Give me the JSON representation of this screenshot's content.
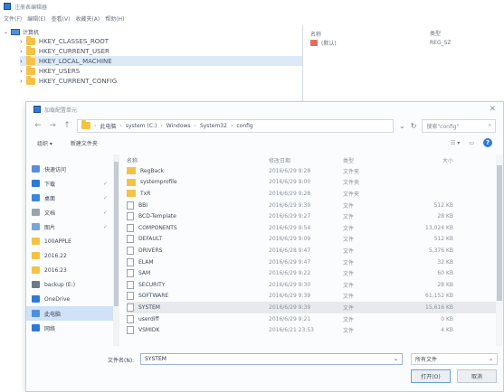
{
  "regedit": {
    "title": "注册表编辑器",
    "menu": [
      "文件(F)",
      "编辑(E)",
      "查看(V)",
      "收藏夹(A)",
      "帮助(H)"
    ],
    "tree_root": "计算机",
    "tree_items": [
      {
        "label": "HKEY_CLASSES_ROOT",
        "selected": false
      },
      {
        "label": "HKEY_CURRENT_USER",
        "selected": false
      },
      {
        "label": "HKEY_LOCAL_MACHINE",
        "selected": true
      },
      {
        "label": "HKEY_USERS",
        "selected": false
      },
      {
        "label": "HKEY_CURRENT_CONFIG",
        "selected": false
      }
    ],
    "values_header": {
      "name": "名称",
      "type": "类型"
    },
    "values_rows": [
      {
        "name": "(默认)",
        "type": "REG_SZ"
      }
    ]
  },
  "dialog": {
    "title": "加载配置单元",
    "breadcrumb": [
      "此电脑",
      "system (C:)",
      "Windows",
      "System32",
      "config"
    ],
    "search_placeholder": "搜索\"config\"",
    "toolbar": {
      "organize": "组织 ▾",
      "new_folder": "新建文件夹"
    },
    "nav_items": [
      {
        "label": "快速访问",
        "color": "#5a8fd6",
        "pinned": false,
        "selected": false
      },
      {
        "label": "下载",
        "color": "#2f79d6",
        "pinned": true,
        "selected": false
      },
      {
        "label": "桌面",
        "color": "#3e86d8",
        "pinned": true,
        "selected": false
      },
      {
        "label": "文档",
        "color": "#9aa4ae",
        "pinned": true,
        "selected": false
      },
      {
        "label": "图片",
        "color": "#7aa6d6",
        "pinned": true,
        "selected": false
      },
      {
        "label": "100APPLE",
        "color": "#f5c246",
        "pinned": false,
        "selected": false
      },
      {
        "label": "2016.22",
        "color": "#f5c246",
        "pinned": false,
        "selected": false
      },
      {
        "label": "2016.23",
        "color": "#f5c246",
        "pinned": false,
        "selected": false
      },
      {
        "label": "backup (E:)",
        "color": "#6f7986",
        "pinned": false,
        "selected": false
      },
      {
        "label": "OneDrive",
        "color": "#2f79d6",
        "pinned": false,
        "selected": false
      },
      {
        "label": "此电脑",
        "color": "#4d90e0",
        "pinned": false,
        "selected": true
      },
      {
        "label": "网络",
        "color": "#2f79d6",
        "pinned": false,
        "selected": false
      }
    ],
    "columns": {
      "name": "名称",
      "date": "修改日期",
      "type": "类型",
      "size": "大小"
    },
    "files": [
      {
        "name": "RegBack",
        "date": "2016/6/29 9:28",
        "type": "文件夹",
        "size": "",
        "folder": true,
        "selected": false
      },
      {
        "name": "systemprofile",
        "date": "2016/6/29 9:00",
        "type": "文件夹",
        "size": "",
        "folder": true,
        "selected": false
      },
      {
        "name": "TxR",
        "date": "2016/6/29 9:28",
        "type": "文件夹",
        "size": "",
        "folder": true,
        "selected": false
      },
      {
        "name": "BBI",
        "date": "2016/6/29 9:39",
        "type": "文件",
        "size": "512 KB",
        "folder": false,
        "selected": false
      },
      {
        "name": "BCD-Template",
        "date": "2016/6/29 9:27",
        "type": "文件",
        "size": "28 KB",
        "folder": false,
        "selected": false
      },
      {
        "name": "COMPONENTS",
        "date": "2016/6/29 9:54",
        "type": "文件",
        "size": "13,024 KB",
        "folder": false,
        "selected": false
      },
      {
        "name": "DEFAULT",
        "date": "2016/6/29 9:09",
        "type": "文件",
        "size": "512 KB",
        "folder": false,
        "selected": false
      },
      {
        "name": "DRIVERS",
        "date": "2016/6/28 9:47",
        "type": "文件",
        "size": "5,376 KB",
        "folder": false,
        "selected": false
      },
      {
        "name": "ELAM",
        "date": "2016/6/29 9:47",
        "type": "文件",
        "size": "32 KB",
        "folder": false,
        "selected": false
      },
      {
        "name": "SAM",
        "date": "2016/6/29 9:22",
        "type": "文件",
        "size": "60 KB",
        "folder": false,
        "selected": false
      },
      {
        "name": "SECURITY",
        "date": "2016/6/29 9:30",
        "type": "文件",
        "size": "28 KB",
        "folder": false,
        "selected": false
      },
      {
        "name": "SOFTWARE",
        "date": "2016/6/29 9:39",
        "type": "文件",
        "size": "61,152 KB",
        "folder": false,
        "selected": false
      },
      {
        "name": "SYSTEM",
        "date": "2016/6/29 9:39",
        "type": "文件",
        "size": "15,616 KB",
        "folder": false,
        "selected": true
      },
      {
        "name": "userdiff",
        "date": "2016/6/29 9:21",
        "type": "文件",
        "size": "0 KB",
        "folder": false,
        "selected": false
      },
      {
        "name": "VSMIDK",
        "date": "2016/6/21 23:53",
        "type": "文件",
        "size": "4 KB",
        "folder": false,
        "selected": false
      }
    ],
    "filename_label": "文件名(N):",
    "filename_value": "SYSTEM",
    "filetype_value": "所有文件",
    "open_label": "打开(O)",
    "cancel_label": "取消"
  }
}
